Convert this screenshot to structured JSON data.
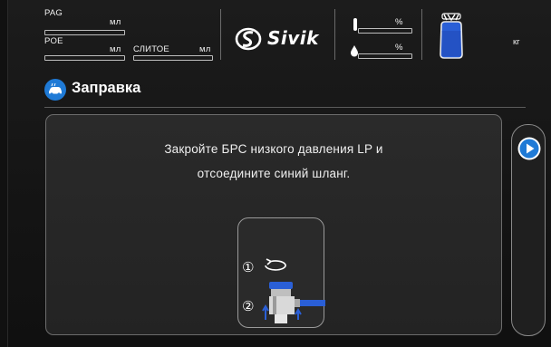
{
  "header": {
    "pag_label": "PAG",
    "pag_unit": "мл",
    "poe_label": "POE",
    "poe_unit": "мл",
    "drain_label": "СЛИТОЕ",
    "drain_unit": "мл",
    "brand": "Sivik",
    "temp_unit": "%",
    "humidity_unit": "%",
    "weight_unit": "кг"
  },
  "page": {
    "title": "Заправка",
    "icon": "car-refill-icon"
  },
  "instruction": {
    "line1": "Закройте БРС низкого давления LP и",
    "line2": "отсоедините синий шланг.",
    "step1": "①",
    "step2": "②"
  },
  "colors": {
    "accent": "#1f7ad6",
    "panel_border": "#6c6c6c",
    "valve_blue": "#2a5fd6"
  }
}
